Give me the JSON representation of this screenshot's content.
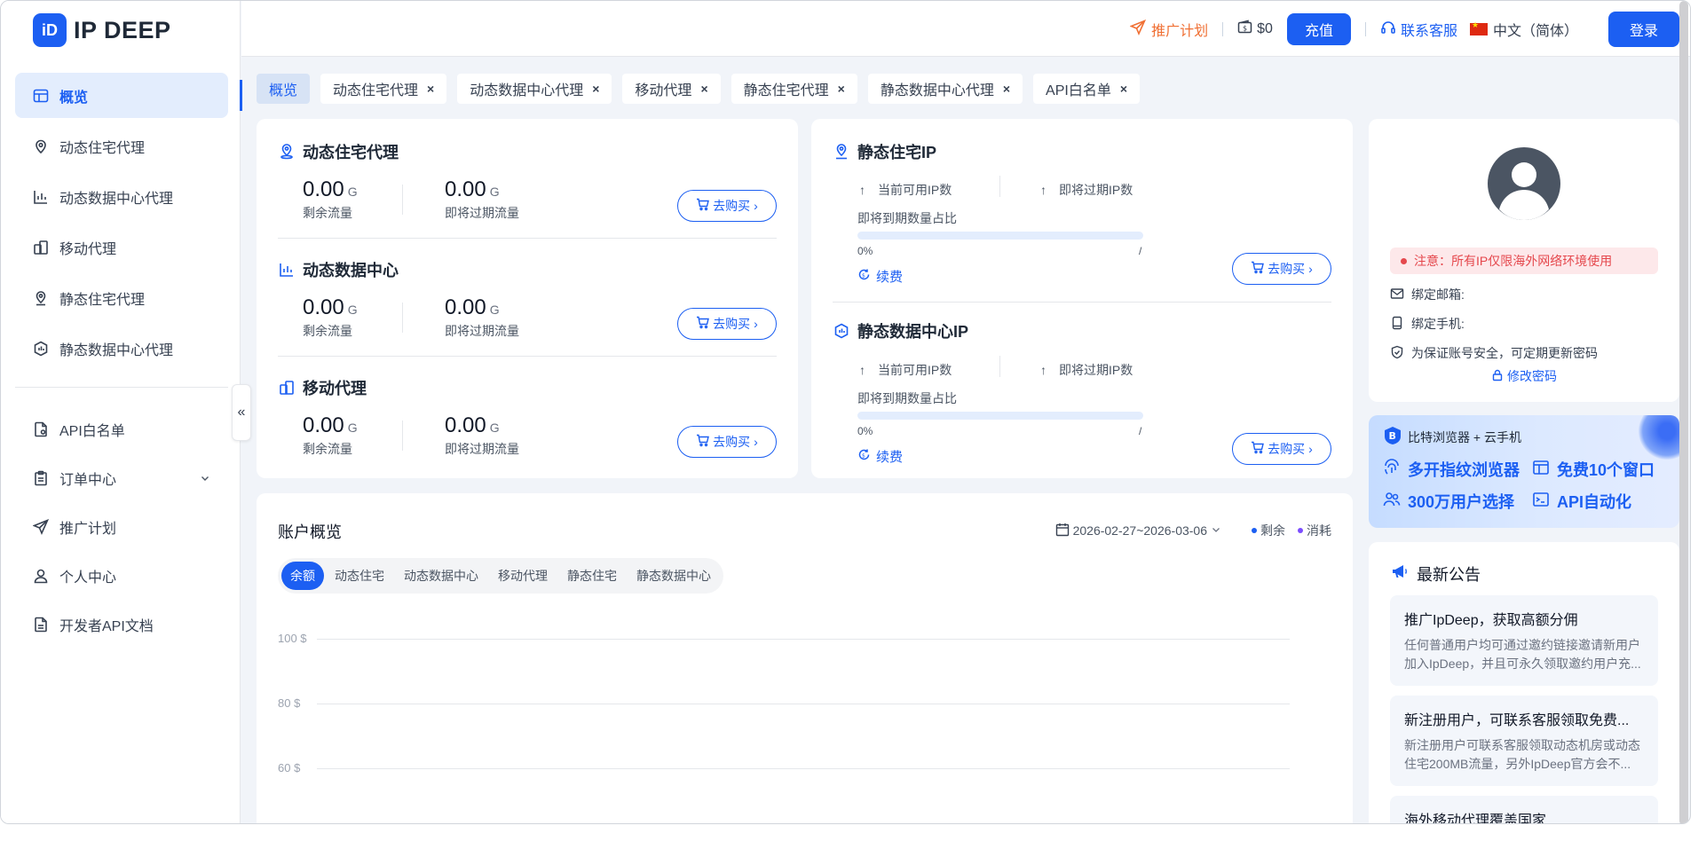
{
  "brand": {
    "name": "IP DEEP",
    "mark": "iD"
  },
  "header": {
    "promo": "推广计划",
    "balance": "$0",
    "recharge": "充值",
    "service": "联系客服",
    "language": "中文（简体）",
    "login": "登录"
  },
  "sidebar": {
    "items": [
      {
        "label": "概览",
        "icon": "layout-icon"
      },
      {
        "label": "动态住宅代理",
        "icon": "location-icon"
      },
      {
        "label": "动态数据中心代理",
        "icon": "datacenter-icon"
      },
      {
        "label": "移动代理",
        "icon": "mobile-icon"
      },
      {
        "label": "静态住宅代理",
        "icon": "location-icon"
      },
      {
        "label": "静态数据中心代理",
        "icon": "shield-icon"
      }
    ],
    "bottom_items": [
      {
        "label": "API白名单",
        "icon": "doc-icon"
      },
      {
        "label": "订单中心",
        "icon": "clipboard-icon"
      },
      {
        "label": "推广计划",
        "icon": "send-icon"
      },
      {
        "label": "个人中心",
        "icon": "user-icon"
      },
      {
        "label": "开发者API文档",
        "icon": "file-icon"
      }
    ],
    "collapse": "«"
  },
  "tabs": [
    {
      "label": "概览",
      "active": true
    },
    {
      "label": "动态住宅代理"
    },
    {
      "label": "动态数据中心代理"
    },
    {
      "label": "移动代理"
    },
    {
      "label": "静态住宅代理"
    },
    {
      "label": "静态数据中心代理"
    },
    {
      "label": "API白名单"
    }
  ],
  "traffic": [
    {
      "title": "动态住宅代理",
      "remain": "0.00",
      "expiring": "0.00",
      "unit": "G",
      "remain_label": "剩余流量",
      "expiring_label": "即将过期流量",
      "buy": "去购买"
    },
    {
      "title": "动态数据中心",
      "remain": "0.00",
      "expiring": "0.00",
      "unit": "G",
      "remain_label": "剩余流量",
      "expiring_label": "即将过期流量",
      "buy": "去购买"
    },
    {
      "title": "移动代理",
      "remain": "0.00",
      "expiring": "0.00",
      "unit": "G",
      "remain_label": "剩余流量",
      "expiring_label": "即将过期流量",
      "buy": "去购买"
    }
  ],
  "static": [
    {
      "title": "静态住宅IP",
      "available": "当前可用IP数",
      "expiring": "即将过期IP数",
      "ratio_label": "即将到期数量占比",
      "percent": "0%",
      "slash": "/",
      "renew": "续费",
      "buy": "去购买"
    },
    {
      "title": "静态数据中心IP",
      "available": "当前可用IP数",
      "expiring": "即将过期IP数",
      "ratio_label": "即将到期数量占比",
      "percent": "0%",
      "slash": "/",
      "renew": "续费",
      "buy": "去购买"
    }
  ],
  "profile": {
    "notice": "注意：所有IP仅限海外网络环境使用",
    "email_label": "绑定邮箱:",
    "phone_label": "绑定手机:",
    "security_tip": "为保证账号安全，可定期更新密码",
    "change_password": "修改密码"
  },
  "banner": {
    "top": "比特浏览器 + 云手机",
    "items": [
      "多开指纹浏览器",
      "免费10个窗口",
      "300万用户选择",
      "API自动化"
    ]
  },
  "announcements": {
    "title": "最新公告",
    "items": [
      {
        "title": "推广IpDeep，获取高额分佣",
        "desc": "任何普通用户均可通过邀约链接邀请新用户加入IpDeep，并且可永久领取邀约用户充..."
      },
      {
        "title": "新注册用户，可联系客服领取免费...",
        "desc": "新注册用户可联系客服领取动态机房或动态住宅200MB流量，另外IpDeep官方会不..."
      },
      {
        "title": "海外移动代理覆盖国家",
        "desc": ""
      }
    ]
  },
  "account": {
    "title": "账户概览",
    "date_range": "2026-02-27~2026-03-06",
    "legend": [
      {
        "label": "剩余",
        "color": "#1c5ff2"
      },
      {
        "label": "消耗",
        "color": "#7c4dff"
      }
    ],
    "segments": [
      "余额",
      "动态住宅",
      "动态数据中心",
      "移动代理",
      "静态住宅",
      "静态数据中心"
    ]
  },
  "chart_data": {
    "type": "line",
    "title": "",
    "ylabel": "",
    "y_ticks": [
      "100 $",
      "80 $",
      "60 $"
    ],
    "ylim": [
      60,
      100
    ],
    "series": [
      {
        "name": "剩余",
        "values": []
      },
      {
        "name": "消耗",
        "values": []
      }
    ]
  }
}
